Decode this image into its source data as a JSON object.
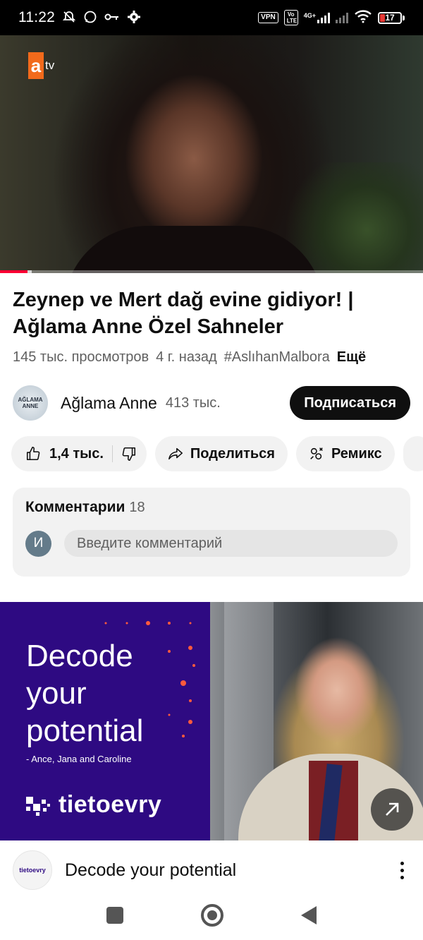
{
  "status_bar": {
    "time": "11:22",
    "vpn": "VPN",
    "volte": "Vo LTE",
    "network": "4G+",
    "battery": "17",
    "icons": [
      "bell-off-icon",
      "whatsapp-icon",
      "key-icon",
      "gear-icon",
      "signal-icon",
      "wifi-icon",
      "battery-icon"
    ],
    "battery_color": "#e53935"
  },
  "video": {
    "channel_logo": "atv",
    "progress": 0.065,
    "buffered": 0.075,
    "progress_color": "#ff0033"
  },
  "title": "Zeynep ve Mert dağ evine gidiyor! | Ağlama Anne Özel Sahneler",
  "meta": {
    "views": "145 тыс. просмотров",
    "age": "4 г. назад",
    "hashtag": "#AslıhanMalbora",
    "more": "Ещё"
  },
  "channel": {
    "avatar_text": "AĞLAMA ANNE",
    "name": "Ağlama Anne",
    "subscribers": "413 тыс.",
    "subscribe_label": "Подписаться"
  },
  "actions": {
    "likes": "1,4 тыс.",
    "share": "Поделиться",
    "remix": "Ремикс"
  },
  "comments": {
    "title": "Комментарии",
    "count": "18",
    "user_initial": "И",
    "placeholder": "Введите комментарий"
  },
  "ad": {
    "headline_line1": "Decode",
    "headline_line2": "your",
    "headline_line3": "potential",
    "subtext": "- Ance, Jana and Caroline",
    "brand": "tietoevry",
    "brand_color": "#2e0a82",
    "title": "Decode your potential",
    "avatar_text": "tietoevry"
  }
}
